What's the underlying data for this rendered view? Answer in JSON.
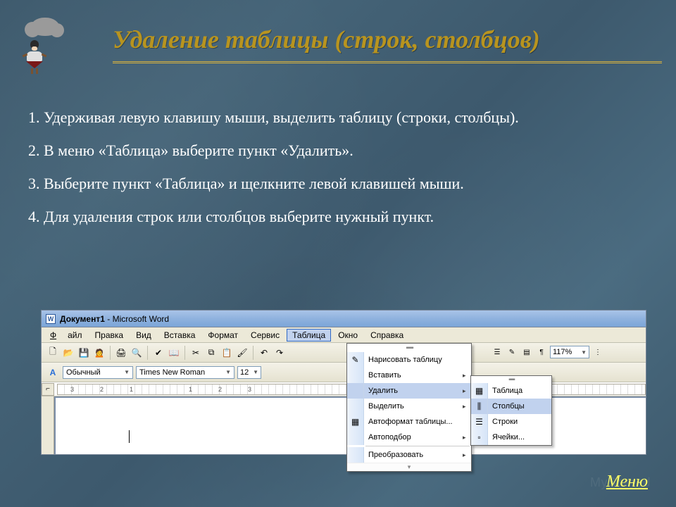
{
  "title": "Удаление таблицы (строк, столбцов)",
  "steps": [
    "1.  Удерживая левую клавишу мыши, выделить таблицу (строки, столбцы).",
    "2. В меню «Таблица» выберите пункт «Удалить».",
    "3. Выберите пункт «Таблица» и щелкните левой клавишей мыши.",
    "4. Для удаления строк или столбцов выберите нужный пункт."
  ],
  "word": {
    "app_icon": "W",
    "title_doc": "Документ1",
    "title_app": " - Microsoft Word",
    "menubar": {
      "file": "Файл",
      "edit": "Правка",
      "view": "Вид",
      "insert": "Вставка",
      "format": "Формат",
      "service": "Сервис",
      "table": "Таблица",
      "window": "Окно",
      "help": "Справка"
    },
    "toolbar": {
      "zoom": "117%"
    },
    "formatbar": {
      "style": "Обычный",
      "font": "Times New Roman",
      "size": "12"
    },
    "ruler_marks": [
      "3",
      "2",
      "1",
      "1",
      "2",
      "3"
    ],
    "table_menu": {
      "draw": "Нарисовать таблицу",
      "insert": "Вставить",
      "delete": "Удалить",
      "select": "Выделить",
      "autoformat": "Автоформат таблицы...",
      "autofit": "Автоподбор",
      "convert": "Преобразовать"
    },
    "delete_submenu": {
      "table": "Таблица",
      "columns": "Столбцы",
      "rows": "Строки",
      "cells": "Ячейки..."
    }
  },
  "footer": {
    "menu_link": "Меню",
    "watermark": "MyShared"
  }
}
